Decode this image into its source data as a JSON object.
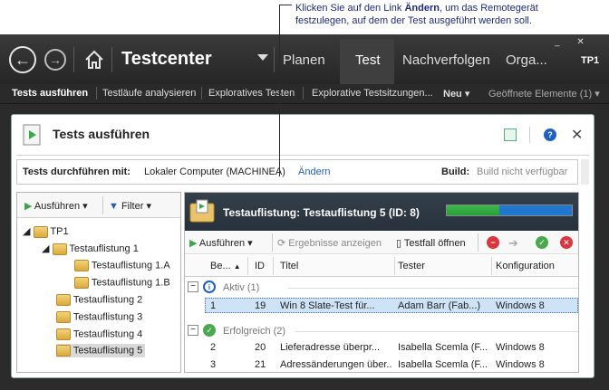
{
  "callout": {
    "text": "Klicken Sie auf den Link Ändern, um das Remotegerät festzulegen, auf dem der Test ausgeführt werden soll.",
    "text_pre": "Klicken Sie auf den Link ",
    "text_bold": "Ändern",
    "text_post": ", um das Remotegerät festzulegen, auf dem der Test ausgeführt werden soll."
  },
  "app": {
    "title": "Testcenter",
    "project": "TP1"
  },
  "hub": {
    "items": [
      "Planen",
      "Test",
      "Nachverfolgen",
      "Orga..."
    ],
    "active": "Test"
  },
  "subnav": {
    "items": [
      "Tests ausführen",
      "Testläufe analysieren",
      "Exploratives Testen",
      "Explorative Testsitzungen...",
      "Neu",
      "Geöffnete Elemente (1)"
    ]
  },
  "panel": {
    "title": "Tests ausführen",
    "run_with_label": "Tests durchführen mit:",
    "run_with_value": "Lokaler Computer (MACHINEA)",
    "change_link": "Ändern",
    "build_label": "Build:",
    "build_value": "Build nicht verfügbar"
  },
  "left_toolbar": {
    "run": "Ausführen",
    "filter": "Filter"
  },
  "tree": {
    "root": "TP1",
    "items": [
      "Testauflistung 1",
      "Testauflistung 1.A",
      "Testauflistung 1.B",
      "Testauflistung 2",
      "Testauflistung 3",
      "Testauflistung 4",
      "Testauflistung 5"
    ],
    "selected": "Testauflistung 5"
  },
  "suite": {
    "title": "Testauflistung: Testauflistung 5 (ID: 8)",
    "progress": 0.42
  },
  "grid_toolbar": {
    "run": "Ausführen",
    "view_results": "Ergebnisse anzeigen",
    "open_testcase": "Testfall öffnen"
  },
  "grid": {
    "columns": [
      "Be...",
      "ID",
      "Titel",
      "Tester",
      "Konfiguration"
    ],
    "groups": [
      {
        "label": "Aktiv (1)",
        "rows": [
          {
            "order": "1",
            "id": "19",
            "title": "Win 8 Slate-Test für...",
            "tester": "Adam Barr (Fab...)",
            "config": "Windows 8"
          }
        ]
      },
      {
        "label": "Erfolgreich (2)",
        "rows": [
          {
            "order": "2",
            "id": "20",
            "title": "Lieferadresse überpr...",
            "tester": "Isabella Scemla (F...",
            "config": "Windows 8"
          },
          {
            "order": "3",
            "id": "21",
            "title": "Adressänderungen über...",
            "tester": "Isabella Scemla (F...",
            "config": "Windows 8"
          }
        ]
      }
    ]
  },
  "colors": {
    "app_bg": "#2b2b2b",
    "accent_blue": "#1f77d0",
    "progress_green": "#33a843",
    "link": "#1f5fbf",
    "selected_row": "#cfe3f7"
  }
}
